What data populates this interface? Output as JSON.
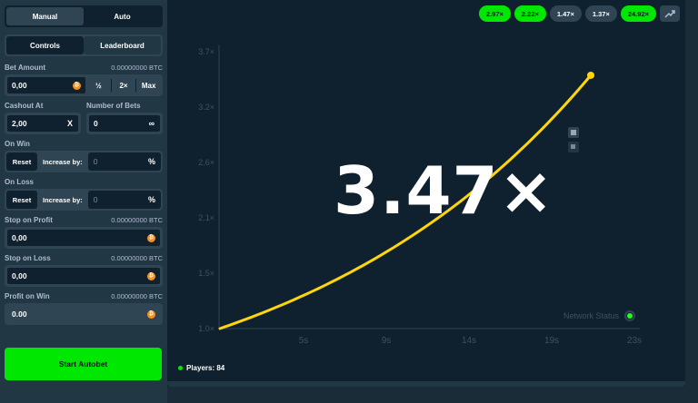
{
  "sidebar": {
    "mode_tabs": [
      "Manual",
      "Auto"
    ],
    "view_tabs": [
      "Controls",
      "Leaderboard"
    ],
    "bet_amount": {
      "label": "Bet Amount",
      "btc": "0.00000000 BTC",
      "value": "0,00",
      "half": "½",
      "double": "2×",
      "max": "Max"
    },
    "cashout": {
      "label": "Cashout At",
      "value": "2,00",
      "suffix": "X"
    },
    "num_bets": {
      "label": "Number of Bets",
      "value": "0",
      "suffix": "∞"
    },
    "on_win": {
      "label": "On Win",
      "reset": "Reset",
      "increase_label": "Increase by:",
      "value": "0",
      "suffix": "%"
    },
    "on_loss": {
      "label": "On Loss",
      "reset": "Reset",
      "increase_label": "Increase by:",
      "value": "0",
      "suffix": "%"
    },
    "stop_profit": {
      "label": "Stop on Profit",
      "btc": "0.00000000 BTC",
      "value": "0,00"
    },
    "stop_loss": {
      "label": "Stop on Loss",
      "btc": "0.00000000 BTC",
      "value": "0,00"
    },
    "profit_win": {
      "label": "Profit on Win",
      "btc": "0.00000000 BTC",
      "value": "0.00"
    },
    "start_button": "Start Autobet"
  },
  "history": [
    {
      "value": "2.97×",
      "status": "green"
    },
    {
      "value": "2.22×",
      "status": "green"
    },
    {
      "value": "1.47×",
      "status": "grey"
    },
    {
      "value": "1.37×",
      "status": "grey"
    },
    {
      "value": "24.92×",
      "status": "green"
    }
  ],
  "game": {
    "multiplier": "3.47×",
    "network_status": "Network Status",
    "players": "Players: 84"
  },
  "chart_data": {
    "type": "line",
    "y_ticks": [
      "1.0×",
      "1.5×",
      "2.1×",
      "2.6×",
      "3.2×",
      "3.7×"
    ],
    "x_ticks": [
      "5s",
      "9s",
      "14s",
      "19s",
      "23s"
    ],
    "series": [
      {
        "values": []
      }
    ],
    "end_value": 3.47,
    "color": "#ffd60a"
  }
}
